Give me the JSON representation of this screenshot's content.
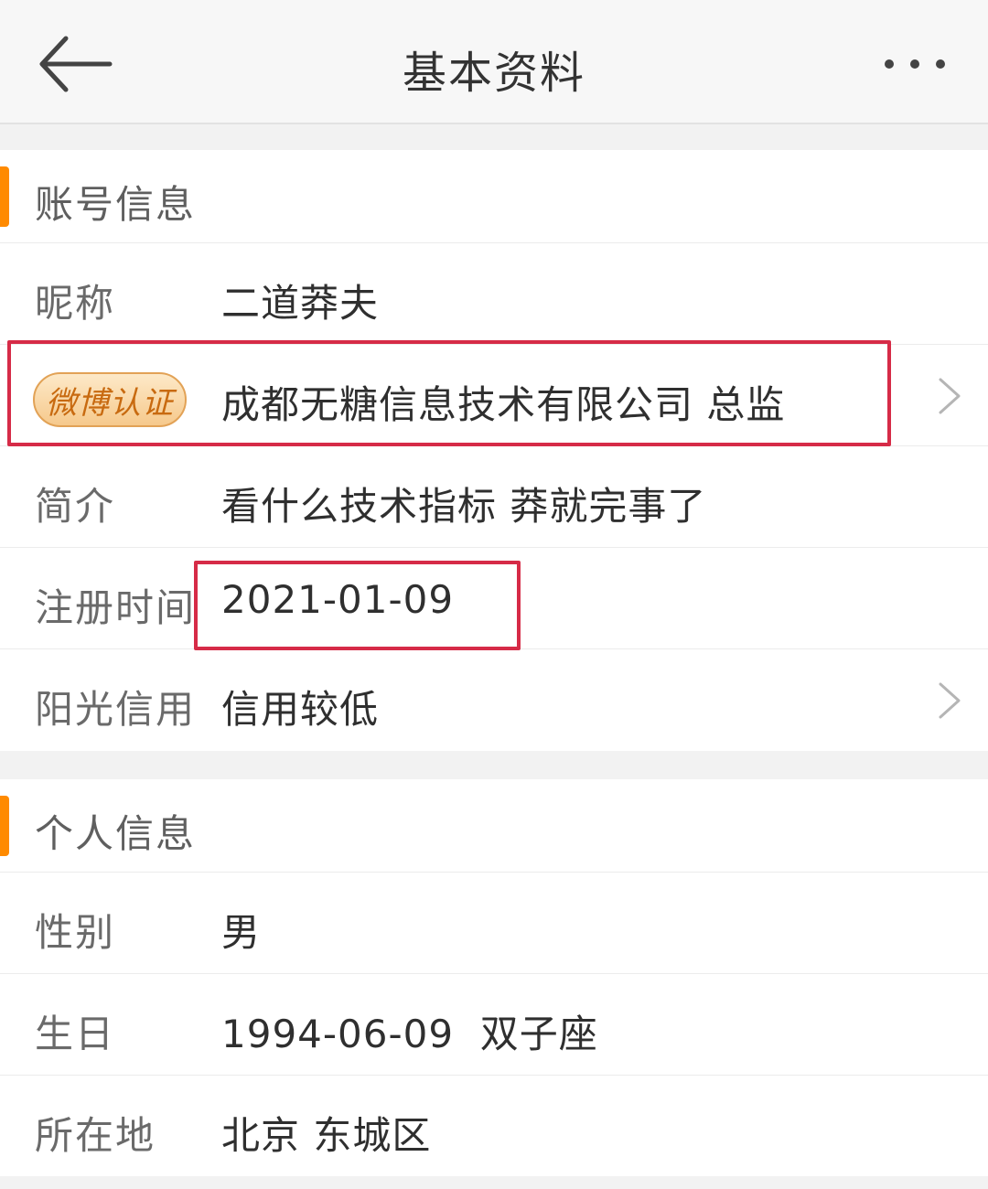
{
  "header": {
    "title": "基本资料",
    "back_icon": "arrow-left-icon",
    "more_icon": "more-horizontal-icon"
  },
  "account_section": {
    "title": "账号信息",
    "accent_color": "#ff8a00",
    "nickname": {
      "label": "昵称",
      "value": "二道莽夫"
    },
    "verification": {
      "badge": "微博认证",
      "value": "成都无糖信息技术有限公司 总监"
    },
    "bio": {
      "label": "简介",
      "value": "看什么技术指标 莽就完事了"
    },
    "register_time": {
      "label": "注册时间",
      "value": "2021-01-09"
    },
    "credit": {
      "label": "阳光信用",
      "value": "信用较低"
    }
  },
  "personal_section": {
    "title": "个人信息",
    "gender": {
      "label": "性别",
      "value": "男"
    },
    "birthday": {
      "label": "生日",
      "value": "1994-06-09  双子座"
    },
    "location": {
      "label": "所在地",
      "value": "北京 东城区"
    }
  },
  "highlight_color": "#d62b47"
}
